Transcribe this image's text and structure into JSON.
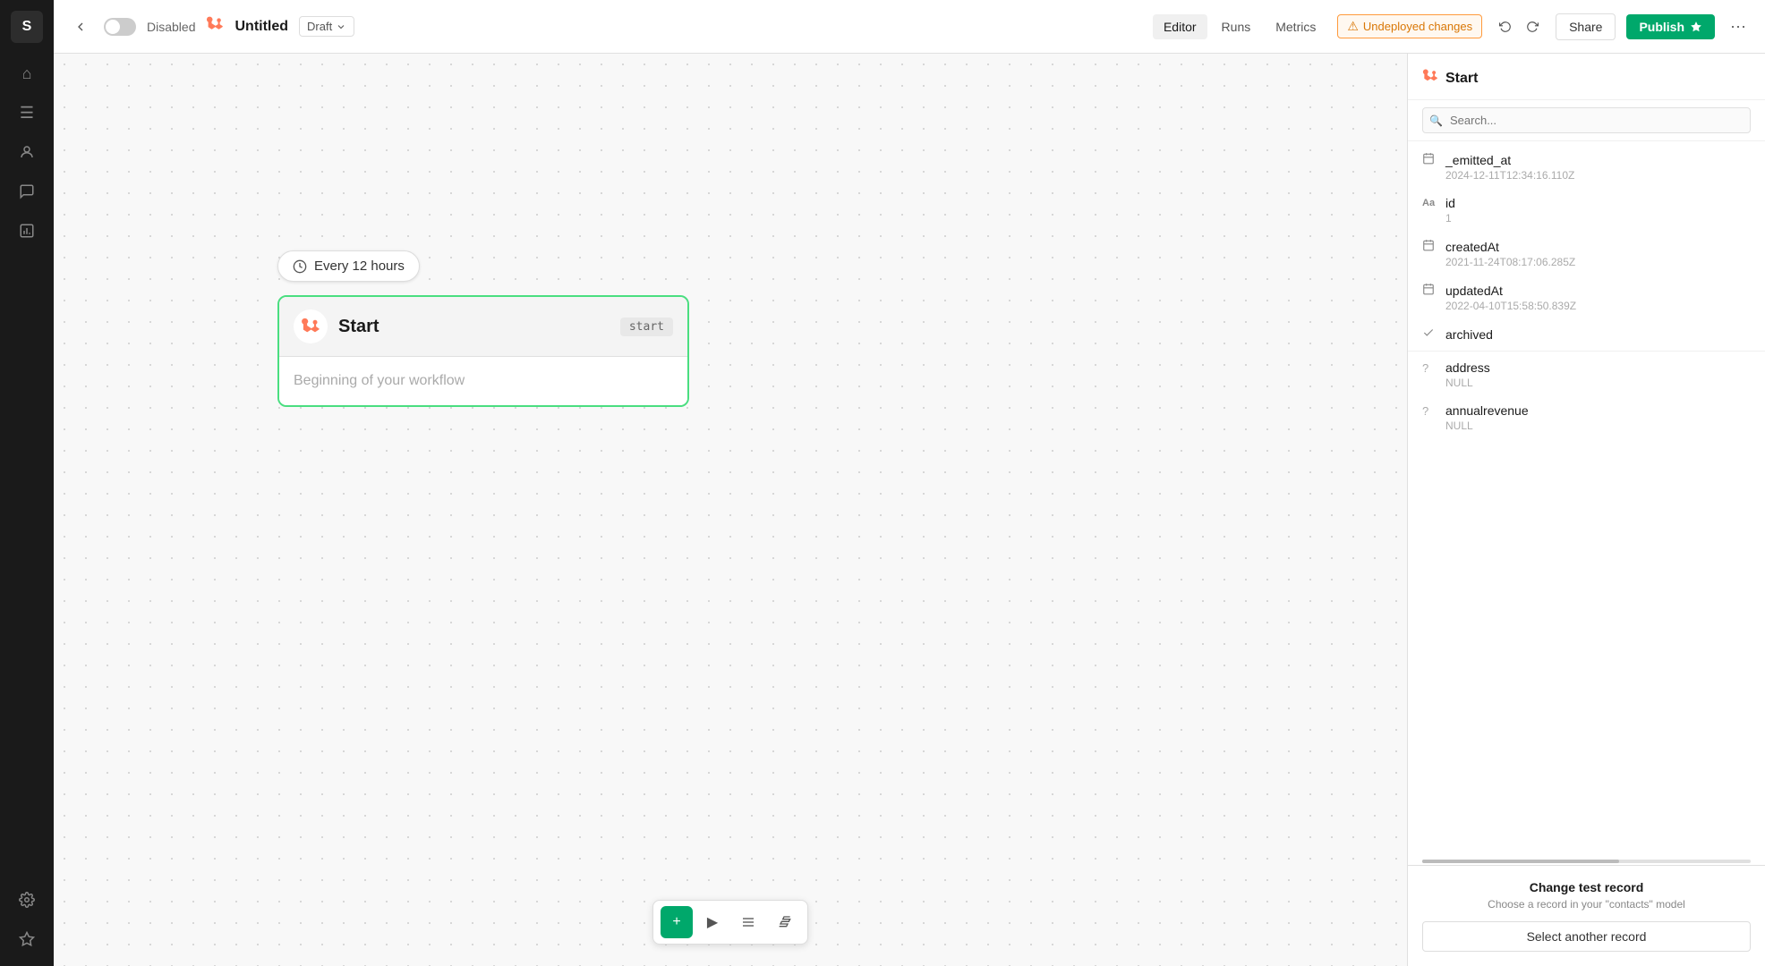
{
  "app": {
    "logo": "S",
    "sidebar_nav": [
      {
        "id": "home",
        "icon": "⌂"
      },
      {
        "id": "data",
        "icon": "☰"
      },
      {
        "id": "contacts",
        "icon": "👤"
      },
      {
        "id": "chat",
        "icon": "💬"
      },
      {
        "id": "reports",
        "icon": "📋"
      },
      {
        "id": "settings",
        "icon": "⚙"
      }
    ],
    "sidebar_bottom": [
      {
        "id": "extensions",
        "icon": "⬡"
      }
    ]
  },
  "header": {
    "disabled_label": "Disabled",
    "workflow_title": "Untitled",
    "draft_label": "Draft",
    "tabs": [
      {
        "id": "editor",
        "label": "Editor",
        "active": true
      },
      {
        "id": "runs",
        "label": "Runs",
        "active": false
      },
      {
        "id": "metrics",
        "label": "Metrics",
        "active": false
      }
    ],
    "undeployed_label": "Undeployed changes",
    "share_label": "Share",
    "publish_label": "Publish"
  },
  "canvas": {
    "schedule_label": "Every 12 hours",
    "node": {
      "title": "Start",
      "tag": "start",
      "body": "Beginning of your workflow"
    }
  },
  "right_panel": {
    "title": "Start",
    "search_placeholder": "Search...",
    "fields": [
      {
        "id": "_emitted_at",
        "icon": "📄",
        "name": "_emitted_at",
        "value": "2024-12-11T12:34:16.110Z",
        "icon_type": "calendar"
      },
      {
        "id": "id",
        "icon": "Aa",
        "name": "id",
        "value": "1",
        "icon_type": "text"
      },
      {
        "id": "createdAt",
        "icon": "📄",
        "name": "createdAt",
        "value": "2021-11-24T08:17:06.285Z",
        "icon_type": "calendar"
      },
      {
        "id": "updatedAt",
        "icon": "📄",
        "name": "updatedAt",
        "value": "2022-04-10T15:58:50.839Z",
        "icon_type": "calendar"
      },
      {
        "id": "archived",
        "icon": "☑",
        "name": "archived",
        "value": "",
        "icon_type": "checkbox"
      },
      {
        "id": "address",
        "icon": "?",
        "name": "address",
        "value": "NULL",
        "icon_type": "unknown"
      },
      {
        "id": "annualrevenue",
        "icon": "?",
        "name": "annualrevenue",
        "value": "NULL",
        "icon_type": "unknown"
      }
    ],
    "change_test_record": "Change test record",
    "change_test_desc": "Choose a record in your \"contacts\" model",
    "select_another_label": "Select another record"
  },
  "toolbar": {
    "add_icon": "+",
    "play_icon": "▶",
    "list_icon": "≡",
    "flag_icon": "⚑"
  }
}
